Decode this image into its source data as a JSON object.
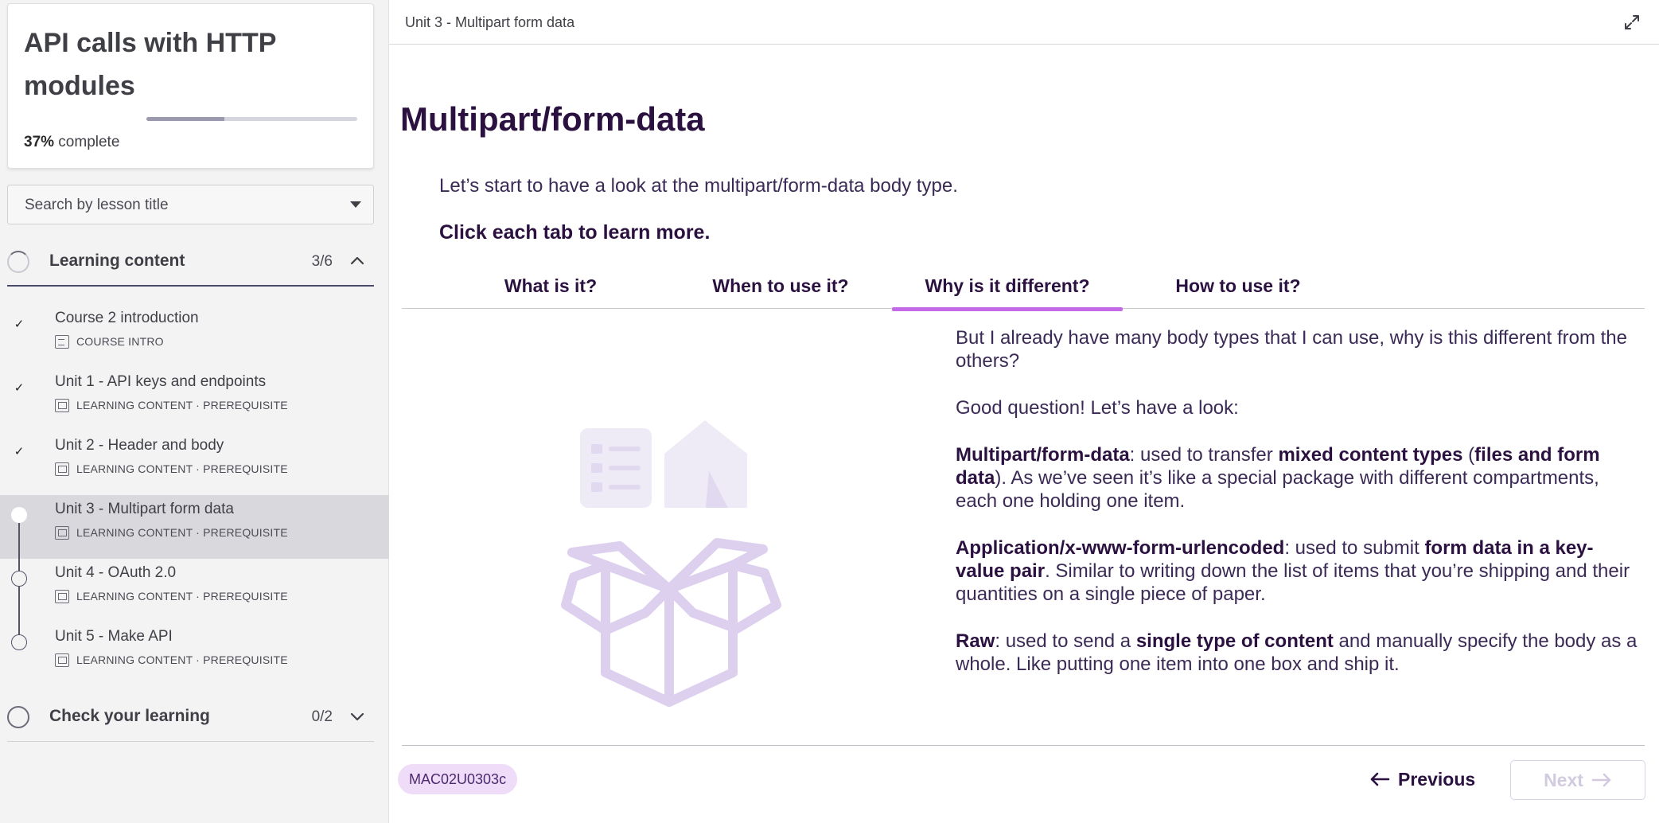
{
  "sidebar": {
    "course_title": "API calls with HTTP modules",
    "progress_percent": "37%",
    "progress_value": 0.37,
    "progress_suffix": " complete",
    "search_placeholder": "Search by lesson title",
    "sections": [
      {
        "label": "Learning content",
        "count": "3/6",
        "expanded": true,
        "lessons": [
          {
            "title": "Course 2 introduction",
            "meta": "COURSE INTRO",
            "status": "done",
            "icon": "document-icon"
          },
          {
            "title": "Unit 1 - API keys and endpoints",
            "meta": "LEARNING CONTENT · PREREQUISITE",
            "status": "done",
            "icon": "slides-icon"
          },
          {
            "title": "Unit 2 - Header and body",
            "meta": "LEARNING CONTENT · PREREQUISITE",
            "status": "done",
            "icon": "slides-icon"
          },
          {
            "title": "Unit 3 - Multipart form data",
            "meta": "LEARNING CONTENT · PREREQUISITE",
            "status": "current",
            "icon": "slides-icon"
          },
          {
            "title": "Unit 4 - OAuth 2.0",
            "meta": "LEARNING CONTENT · PREREQUISITE",
            "status": "todo",
            "icon": "slides-icon"
          },
          {
            "title": "Unit 5 - Make API",
            "meta": "LEARNING CONTENT · PREREQUISITE",
            "status": "todo",
            "icon": "slides-icon"
          }
        ]
      },
      {
        "label": "Check your learning",
        "count": "0/2",
        "expanded": false
      }
    ]
  },
  "header": {
    "breadcrumb": "Unit 3 - Multipart form data",
    "expand_icon": "expand-icon"
  },
  "main": {
    "title": "Multipart/form-data",
    "intro": "Let’s start to have a look at the multipart/form-data body type.",
    "cta": "Click each tab to learn more.",
    "tabs": [
      "What is it?",
      "When to use it?",
      "Why is it different?",
      "How to use it?"
    ],
    "active_tab": 2,
    "content": {
      "p1": "But I already have many body types that I can use, why is this different from the others?",
      "p2": "Good question! Let’s have a look:",
      "p3": {
        "term": "Multipart/form-data",
        "t1": ": used to transfer ",
        "b1": "mixed content types",
        "t2": " (",
        "b2": "files and form data",
        "t3": "). As we’ve seen it’s like a special package with different compartments, each one holding one item."
      },
      "p4": {
        "term": "Application/x-www-form-urlencoded",
        "t1": ": used to submit ",
        "b1": "form data in a key-value pair",
        "t2": ". Similar to writing down the list of items that you’re shipping and their quantities on a single piece of paper."
      },
      "p5": {
        "term": "Raw",
        "t1": ": used to send a ",
        "b1": "single type of content",
        "t2": " and manually specify the body as a whole. Like putting one item into one box and ship it."
      }
    }
  },
  "footer": {
    "code": "MAC02U0303c",
    "previous_label": "Previous",
    "next_label": "Next"
  },
  "colors": {
    "accent": "#c46ae8",
    "heading": "#2b1140",
    "badge_bg": "#eedcf8",
    "sidebar_bg": "#f3f3f4"
  }
}
